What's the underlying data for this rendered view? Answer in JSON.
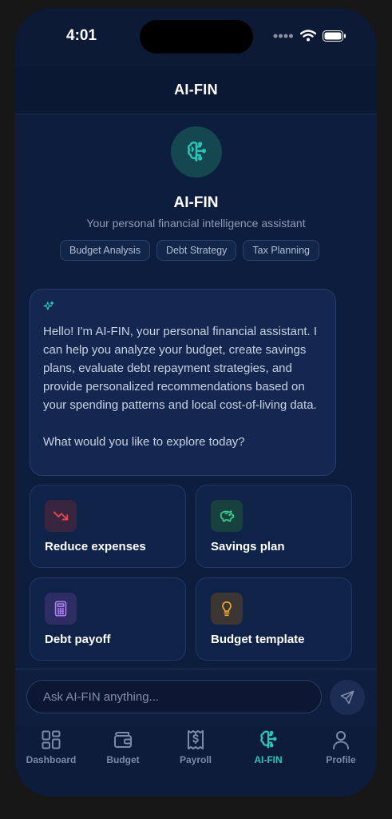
{
  "status_bar": {
    "time": "4:01"
  },
  "header": {
    "title": "AI-FIN"
  },
  "hero": {
    "title": "AI-FIN",
    "subtitle": "Your personal financial intelligence assistant",
    "chips": [
      "Budget Analysis",
      "Debt Strategy",
      "Tax Planning"
    ]
  },
  "message": {
    "text": "Hello! I'm AI-FIN, your personal financial assistant. I can help you analyze your budget, create savings plans, evaluate debt repayment strategies, and provide personalized recommendations based on your spending patterns and local cost-of-living data.\n\nWhat would you like to explore today?"
  },
  "quick_actions": [
    {
      "label": "Reduce expenses",
      "icon": "trending-down-icon",
      "color": "#e5484d",
      "bg": "#3a2540"
    },
    {
      "label": "Savings plan",
      "icon": "piggy-bank-icon",
      "color": "#3ccf8e",
      "bg": "#17403e"
    },
    {
      "label": "Debt payoff",
      "icon": "calculator-icon",
      "color": "#a97cf0",
      "bg": "#2d2d63"
    },
    {
      "label": "Budget template",
      "icon": "lightbulb-icon",
      "color": "#f0a830",
      "bg": "#3b3533"
    }
  ],
  "composer": {
    "placeholder": "Ask AI-FIN anything..."
  },
  "tabs": [
    {
      "label": "Dashboard",
      "icon": "dashboard-icon"
    },
    {
      "label": "Budget",
      "icon": "wallet-icon"
    },
    {
      "label": "Payroll",
      "icon": "receipt-icon"
    },
    {
      "label": "AI-FIN",
      "icon": "brain-icon",
      "active": true
    },
    {
      "label": "Profile",
      "icon": "user-icon"
    }
  ],
  "colors": {
    "accent": "#2cc5b8",
    "background": "#0d1d3d",
    "card": "#0f2349"
  }
}
